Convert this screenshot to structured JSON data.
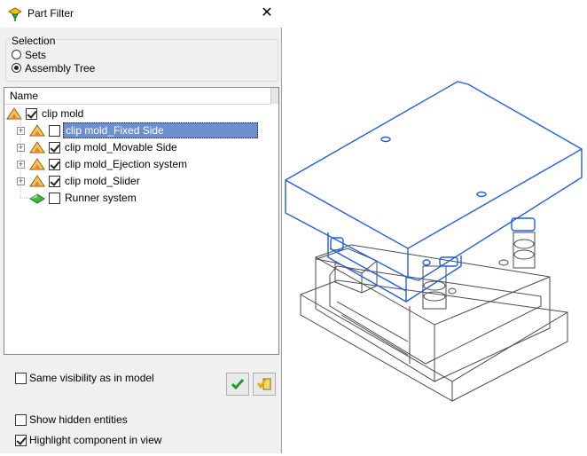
{
  "dialog": {
    "title": "Part Filter",
    "close_glyph": "✕",
    "selection": {
      "label": "Selection",
      "options": [
        {
          "label": "Sets",
          "selected": false
        },
        {
          "label": "Assembly Tree",
          "selected": true
        }
      ]
    },
    "tree": {
      "column_header": "Name",
      "root": {
        "label": "clip mold",
        "checked": true,
        "icon": "assembly-icon"
      },
      "items": [
        {
          "label": "clip mold_Fixed Side",
          "checked": false,
          "expandable": true,
          "selected": true,
          "icon": "assembly-icon"
        },
        {
          "label": "clip mold_Movable Side",
          "checked": true,
          "expandable": true,
          "selected": false,
          "icon": "assembly-icon"
        },
        {
          "label": "clip mold_Ejection system",
          "checked": true,
          "expandable": true,
          "selected": false,
          "icon": "assembly-icon"
        },
        {
          "label": "clip mold_Slider",
          "checked": true,
          "expandable": true,
          "selected": false,
          "icon": "assembly-icon"
        },
        {
          "label": "Runner system",
          "checked": false,
          "expandable": false,
          "selected": false,
          "icon": "part-icon"
        }
      ]
    },
    "options": {
      "same_visibility": {
        "label": "Same visibility as in model",
        "checked": false
      },
      "show_hidden": {
        "label": "Show hidden entities",
        "checked": false
      },
      "highlight_component": {
        "label": "Highlight component in view",
        "checked": true
      }
    },
    "buttons": {
      "ok_icon": "green-check-icon",
      "apply_icon": "apply-filter-icon"
    }
  },
  "viewport": {
    "highlight_color": "#1f5fe0",
    "edge_color": "#4a4a4a"
  }
}
